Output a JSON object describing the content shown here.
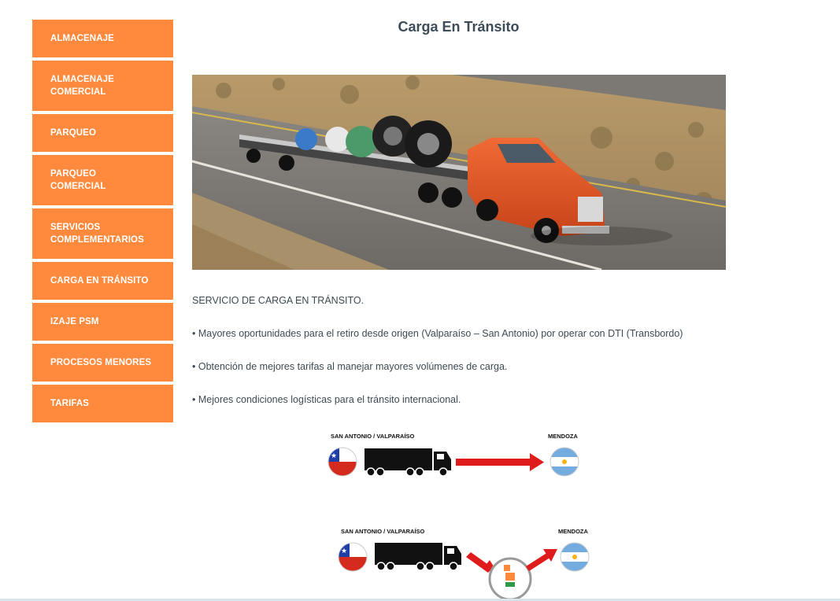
{
  "sidebar": {
    "items": [
      {
        "label": "ALMACENAJE"
      },
      {
        "label": "ALMACENAJE COMERCIAL"
      },
      {
        "label": "PARQUEO"
      },
      {
        "label": "PARQUEO COMERCIAL"
      },
      {
        "label": "SERVICIOS COMPLEMENTARIOS"
      },
      {
        "label": "CARGA EN TRÁNSITO"
      },
      {
        "label": "IZAJE PSM"
      },
      {
        "label": "PROCESOS MENORES"
      },
      {
        "label": "TARIFAS"
      }
    ]
  },
  "main": {
    "title": "Carga En Tránsito",
    "intro": "SERVICIO DE CARGA EN TRÁNSITO.",
    "bullets": [
      "• Mayores oportunidades para el retiro desde origen (Valparaíso – San Antonio) por operar con DTI (Transbordo)",
      "• Obtención de mejores tarifas al manejar mayores volúmenes de carga.",
      "• Mejores condiciones logísticas para el tránsito internacional."
    ]
  },
  "diagrams": [
    {
      "origin": "SAN ANTONIO / VALPARAÍSO",
      "destination": "MENDOZA"
    },
    {
      "origin": "SAN ANTONIO / VALPARAÍSO",
      "destination": "MENDOZA"
    }
  ],
  "colors": {
    "sidebar_bg": "#ff8a3d",
    "title": "#3d4c57",
    "arrow_red": "#e01b1b",
    "truck_cab": "#e85a2a"
  }
}
